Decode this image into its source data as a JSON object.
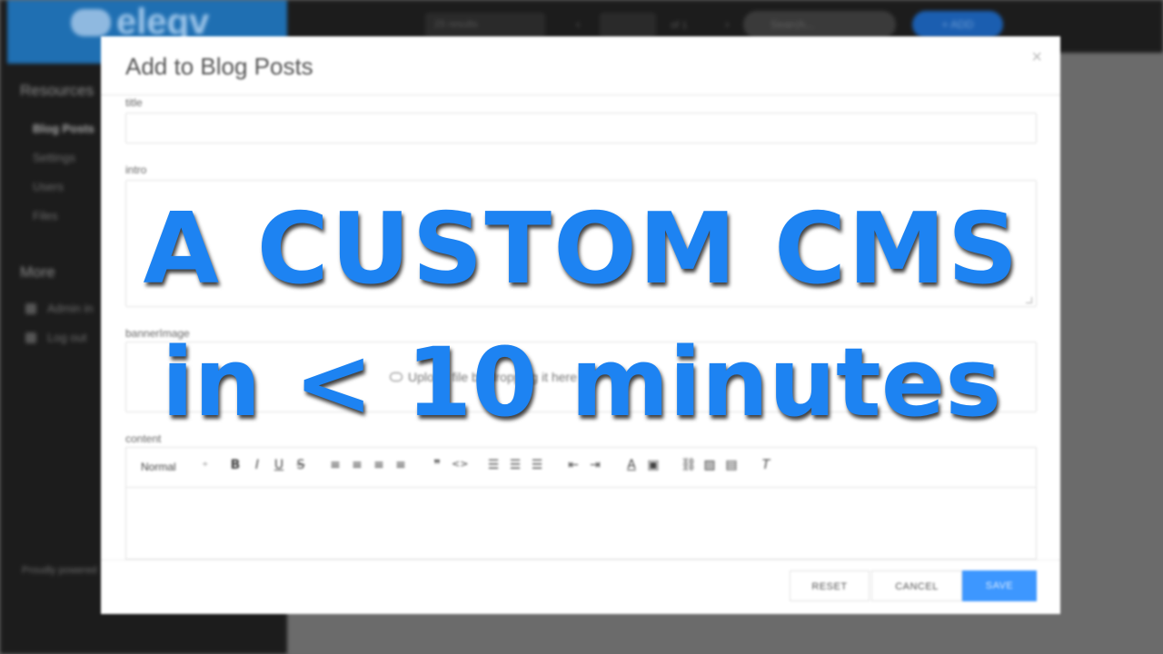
{
  "sidebar": {
    "brand": "eleqv",
    "sections": [
      {
        "title": "Resources",
        "items": [
          "Blog Posts",
          "Settings",
          "Users",
          "Files"
        ]
      },
      {
        "title": "More",
        "items": [
          "Admin in",
          "Log out"
        ]
      }
    ],
    "footer": "Proudly powered"
  },
  "topbar": {
    "per_page": "25 results",
    "page": "1",
    "of_pages": "of 1",
    "search_placeholder": "Search...",
    "add_label": "+ ADD"
  },
  "modal": {
    "title": "Add to Blog Posts",
    "close_icon": "×",
    "fields": {
      "title_label": "title",
      "intro_label": "intro",
      "banner_label": "bannerImage",
      "banner_upload_text": "Upload file by dropping it here",
      "content_label": "content"
    },
    "toolbar": {
      "format": "Normal",
      "caret": "÷",
      "bold": "B",
      "italic": "I",
      "underline": "U",
      "strike": "S",
      "quote": "❞",
      "code": "<>",
      "color": "A",
      "clear": "T"
    },
    "buttons": {
      "reset": "RESET",
      "cancel": "CANCEL",
      "save": "SAVE"
    }
  },
  "overlay": {
    "line1": "A CUSTOM CMS",
    "line2": "in < 10 minutes"
  },
  "colors": {
    "accent": "#1d83f2",
    "save": "#3d97ff",
    "sidebar": "#1c1c1c"
  }
}
